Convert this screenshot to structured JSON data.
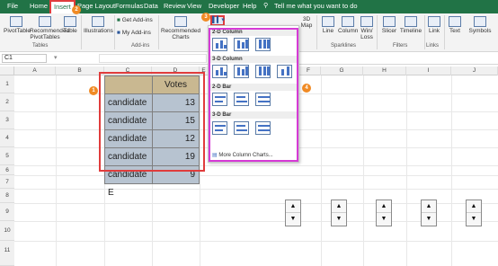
{
  "tabs": [
    "File",
    "Home",
    "Insert",
    "Page Layout",
    "Formulas",
    "Data",
    "Review",
    "View",
    "Developer",
    "Help",
    "Tell me what you want to do"
  ],
  "ribbon": {
    "pivottable": "PivotTable",
    "recommended_pivot": "Recommended PivotTables",
    "table": "Table",
    "group_tables": "Tables",
    "illustrations": "Illustrations",
    "get_addins": "Get Add-ins",
    "my_addins": "My Add-ins",
    "group_addins": "Add-ins",
    "recommended_charts": "Recommended Charts",
    "map": "3D Map",
    "line": "Line",
    "column": "Column",
    "winloss": "Win/ Loss",
    "group_sparklines": "Sparklines",
    "slicer": "Slicer",
    "timeline": "Timeline",
    "group_filters": "Filters",
    "link": "Link",
    "group_links": "Links",
    "text": "Text",
    "symbols": "Symbols"
  },
  "namebox": "C1",
  "columns": [
    "A",
    "B",
    "C",
    "D",
    "E",
    "F",
    "G",
    "H",
    "I",
    "J"
  ],
  "rows": [
    "1",
    "2",
    "3",
    "4",
    "5",
    "6",
    "7",
    "8",
    "9",
    "10",
    "11"
  ],
  "table": {
    "header": "Votes",
    "rows": [
      {
        "name": "candidate A",
        "votes": "13"
      },
      {
        "name": "candidate B",
        "votes": "15"
      },
      {
        "name": "candidate C",
        "votes": "12"
      },
      {
        "name": "candidate D",
        "votes": "19"
      },
      {
        "name": "candidate E",
        "votes": "9"
      }
    ]
  },
  "gallery": {
    "col2d": "2-D Column",
    "col3d": "3-D Column",
    "bar2d": "2-D Bar",
    "bar3d": "3-D Bar",
    "more": "More Column Charts..."
  },
  "badges": [
    "1",
    "2",
    "3",
    "4"
  ],
  "spinner": {
    "up": "▲",
    "down": "▼"
  }
}
